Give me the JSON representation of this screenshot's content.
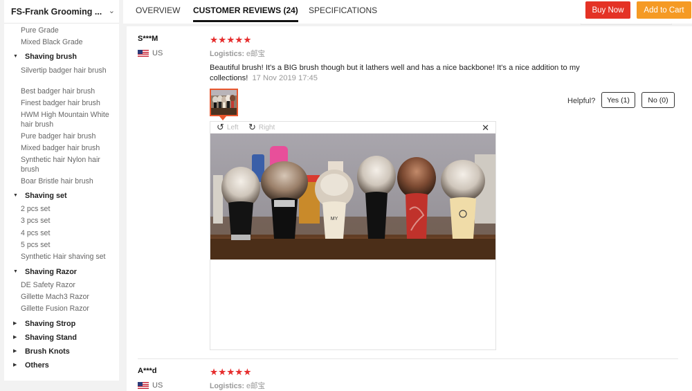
{
  "store": {
    "name": "FS-Frank Grooming ...",
    "chevron_icon": "chevron-down-icon"
  },
  "sidebar": {
    "items": [
      {
        "label": "Pure Grade",
        "kind": "sub"
      },
      {
        "label": "Mixed Black Grade",
        "kind": "sub"
      },
      {
        "label": "Shaving brush",
        "kind": "head",
        "expanded": true
      },
      {
        "label": "Silvertip badger hair brush",
        "kind": "sub"
      },
      {
        "label": "Best badger hair brush",
        "kind": "sub"
      },
      {
        "label": "Finest badger hair brush",
        "kind": "sub"
      },
      {
        "label": "HWM High Mountain White hair brush",
        "kind": "sub"
      },
      {
        "label": "Pure badger hair brush",
        "kind": "sub"
      },
      {
        "label": "Mixed badger hair brush",
        "kind": "sub"
      },
      {
        "label": "Synthetic hair Nylon hair brush",
        "kind": "sub"
      },
      {
        "label": "Boar Bristle hair brush",
        "kind": "sub"
      },
      {
        "label": "Shaving set",
        "kind": "head",
        "expanded": true
      },
      {
        "label": "2 pcs set",
        "kind": "sub"
      },
      {
        "label": "3 pcs set",
        "kind": "sub"
      },
      {
        "label": "4 pcs set",
        "kind": "sub"
      },
      {
        "label": "5 pcs set",
        "kind": "sub"
      },
      {
        "label": "Synthetic Hair shaving set",
        "kind": "sub"
      },
      {
        "label": "Shaving Razor",
        "kind": "head",
        "expanded": true
      },
      {
        "label": "DE Safety Razor",
        "kind": "sub"
      },
      {
        "label": "Gillette Mach3 Razor",
        "kind": "sub"
      },
      {
        "label": "Gillette Fusion Razor",
        "kind": "sub"
      },
      {
        "label": "Shaving Strop",
        "kind": "head",
        "expanded": false
      },
      {
        "label": "Shaving Stand",
        "kind": "head",
        "expanded": false
      },
      {
        "label": "Brush Knots",
        "kind": "head",
        "expanded": false
      },
      {
        "label": "Others",
        "kind": "head",
        "expanded": false
      }
    ]
  },
  "tabs": [
    {
      "label": "OVERVIEW",
      "active": false
    },
    {
      "label": "CUSTOMER REVIEWS (24)",
      "active": true
    },
    {
      "label": "SPECIFICATIONS",
      "active": false
    }
  ],
  "actions": {
    "buy_now": "Buy Now",
    "add_to_cart": "Add to Cart"
  },
  "colors": {
    "buy_now": "#e43225",
    "add_to_cart": "#f59a24",
    "stars": "#e62e2e",
    "thumb_border": "#e8562d"
  },
  "reviews": [
    {
      "name": "S***M",
      "country": "US",
      "stars": "★★★★★",
      "rating": 5,
      "logistics_label": "Logistics:",
      "logistics_value": "e邮宝",
      "text": "Beautiful brush! It's a BIG brush though but it lathers well and has a nice backbone! It's a nice addition to my collections!",
      "date": "17 Nov 2019 17:45",
      "helpful_label": "Helpful?",
      "yes_label": "Yes (1)",
      "no_label": "No (0)",
      "viewer": {
        "rotate_left": "Left",
        "rotate_right": "Right",
        "close_icon": "close-icon"
      }
    },
    {
      "name": "A***d",
      "country": "US",
      "stars": "★★★★★",
      "rating": 5,
      "logistics_label": "Logistics:",
      "logistics_value": "e邮宝"
    }
  ]
}
